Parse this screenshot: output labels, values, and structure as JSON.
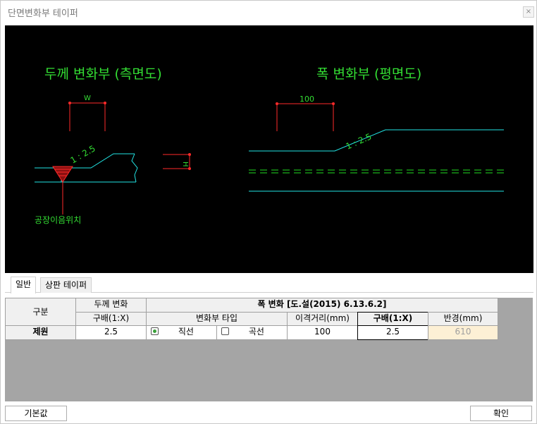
{
  "window": {
    "title": "단면변화부 테이퍼",
    "close_glyph": "×"
  },
  "drawing": {
    "side_title": "두께 변화부 (측면도)",
    "plan_title": "폭 변화부 (평면도)",
    "dim_w": "W",
    "dim_h": "H",
    "dim_plan": "100",
    "slope_side": "1 : 2.5",
    "slope_plan": "1 : 2.5",
    "weld_label": "공장이음위치",
    "colors": {
      "title": "#33dd33",
      "line": "#22e5e5",
      "dim": "#ff2a2a",
      "centerline": "#22dd22"
    }
  },
  "tabs": [
    {
      "label": "일반",
      "active": true
    },
    {
      "label": "상판 테이퍼",
      "active": false
    }
  ],
  "table": {
    "col_group": "구분",
    "thickness_change": "두께 변화",
    "width_change": "폭 변화 [도.설(2015) 6.13.6.2]",
    "slope_header": "구배(1:X)",
    "transition_type": "변화부 타입",
    "offset_distance": "이격거리(mm)",
    "width_slope": "구배(1:X)",
    "radius": "반경(mm)",
    "row_label": "제원",
    "thickness_slope_value": "2.5",
    "type_straight": "직선",
    "type_curve": "곡선",
    "selected_type": "직선",
    "offset_value": "100",
    "width_slope_value": "2.5",
    "radius_value": "610"
  },
  "buttons": {
    "default": "기본값",
    "ok": "확인"
  }
}
